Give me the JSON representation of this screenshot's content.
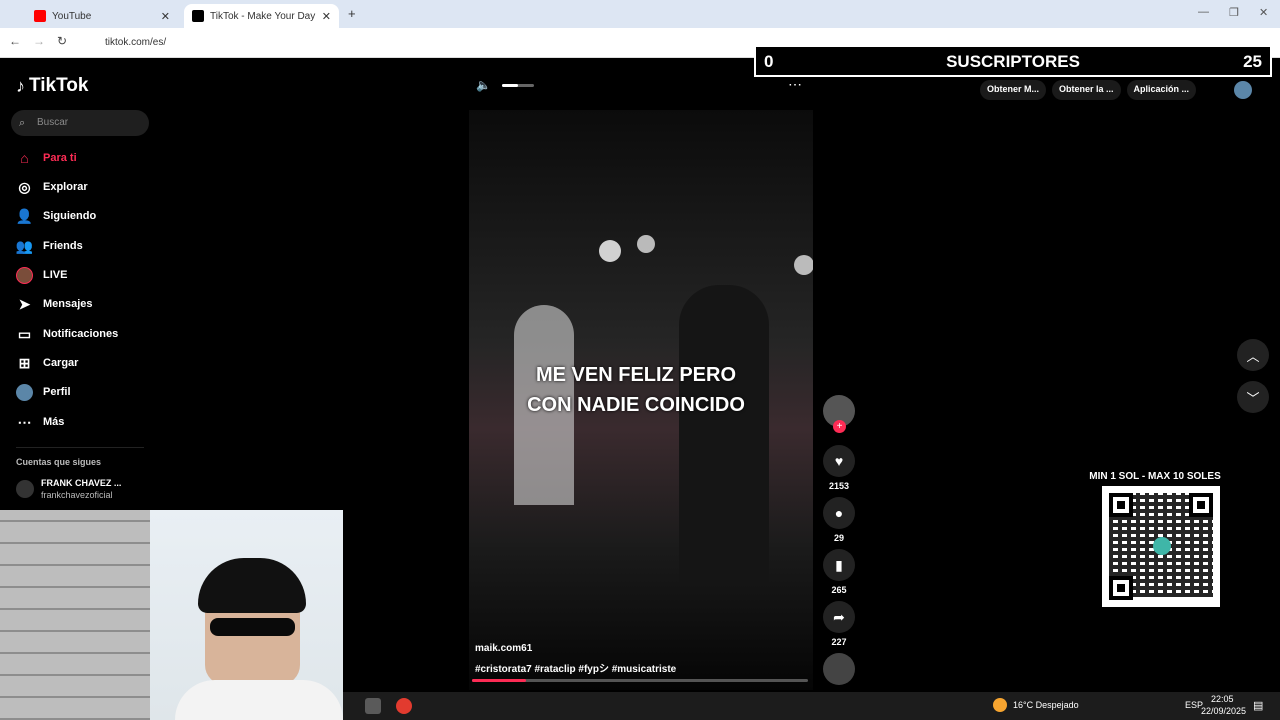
{
  "browser": {
    "tabs": [
      {
        "label": "YouTube",
        "active": false,
        "color": "#ff0000"
      },
      {
        "label": "TikTok - Make Your Day",
        "active": true,
        "color": "#000000"
      }
    ],
    "url": "tiktok.com/es/"
  },
  "sidebar": {
    "logo": "TikTok",
    "search_placeholder": "Buscar",
    "items": [
      {
        "label": "Para ti",
        "icon": "home-icon"
      },
      {
        "label": "Explorar",
        "icon": "compass-icon"
      },
      {
        "label": "Siguiendo",
        "icon": "following-icon"
      },
      {
        "label": "Friends",
        "icon": "friends-icon"
      },
      {
        "label": "LIVE",
        "icon": "live-icon"
      },
      {
        "label": "Mensajes",
        "icon": "send-icon"
      },
      {
        "label": "Notificaciones",
        "icon": "inbox-icon"
      },
      {
        "label": "Cargar",
        "icon": "upload-icon"
      },
      {
        "label": "Perfil",
        "icon": "avatar-icon"
      },
      {
        "label": "Más",
        "icon": "more-icon"
      }
    ],
    "following_header": "Cuentas que sigues",
    "following": {
      "name": "FRANK CHAVEZ ...",
      "user": "frankchavezoficial"
    }
  },
  "overlay": {
    "subs_left": "0",
    "subs_title": "SUSCRIPTORES",
    "subs_right": "25",
    "qr_title": "MIN 1 SOL - MAX 10 SOLES"
  },
  "top_buttons": [
    "Obtener M...",
    "Obtener la ...",
    "Aplicación ..."
  ],
  "video": {
    "caption_line1": "ME VEN FELIZ PERO",
    "caption_line2": "CON NADIE COINCIDO",
    "author": "maik.com61",
    "tags": "#cristorata7  #rataclip  #fypシ  #musicatriste",
    "progress": 0.16
  },
  "actions": {
    "likes": "2153",
    "comments": "29",
    "saves": "265",
    "shares": "227"
  },
  "taskbar": {
    "weather": "16°C  Despejado",
    "lang": "ESP",
    "time": "22:05",
    "date": "22/09/2025"
  }
}
